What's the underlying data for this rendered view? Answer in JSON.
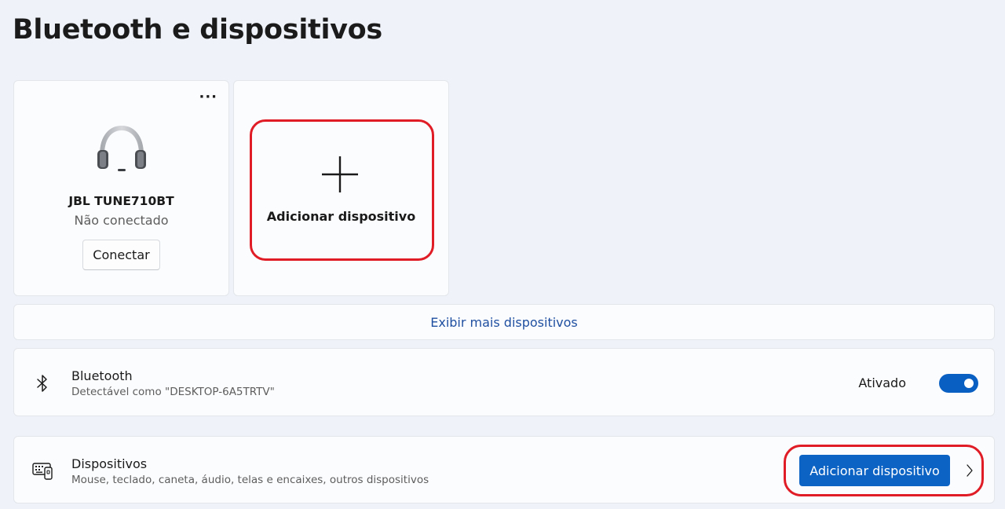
{
  "page": {
    "title": "Bluetooth e dispositivos"
  },
  "device_card": {
    "more_label": "···",
    "icon": "headset-icon",
    "name": "JBL TUNE710BT",
    "status": "Não conectado",
    "connect_label": "Conectar"
  },
  "add_card": {
    "icon": "plus-icon",
    "label": "Adicionar dispositivo"
  },
  "more_devices": {
    "label": "Exibir mais dispositivos"
  },
  "bluetooth": {
    "icon": "bluetooth-icon",
    "title": "Bluetooth",
    "subtitle": "Detectável como \"DESKTOP-6A5TRTV\"",
    "state_label": "Ativado",
    "enabled": true
  },
  "devices": {
    "icon": "keyboard-device-icon",
    "title": "Dispositivos",
    "subtitle": "Mouse, teclado, caneta, áudio, telas e encaixes, outros dispositivos",
    "button_label": "Adicionar dispositivo",
    "chevron_icon": "chevron-right-icon"
  },
  "colors": {
    "accent": "#0d63c4",
    "link": "#1f4fa0",
    "highlight": "#e01d26",
    "background": "#eff3f9"
  }
}
